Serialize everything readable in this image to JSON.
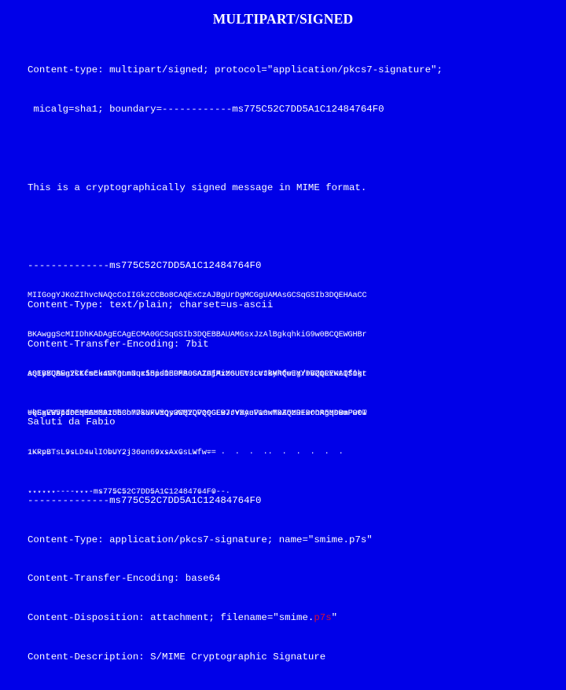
{
  "slide": {
    "title": "MULTIPART/SIGNED",
    "background_color": "#0000e8",
    "text_color": "#ffffff",
    "highlight_color": "#d81038"
  },
  "headers": {
    "line1": "Content-type: multipart/signed; protocol=\"application/pkcs7-signature\";",
    "line2": " micalg=sha1; boundary=------------ms775C52C7DD5A1C12484764F0",
    "blank1": " ",
    "line3": "This is a cryptographically signed message in MIME format.",
    "blank2": " ",
    "line4": "--------------ms775C52C7DD5A1C12484764F0",
    "line5": "Content-Type: text/plain; charset=us-ascii",
    "line6": "Content-Transfer-Encoding: 7bit",
    "blank3": " ",
    "line7": "Saluti da Fabio",
    "blank4": " ",
    "line8": "--------------ms775C52C7DD5A1C12484764F0",
    "line9": "Content-Type: application/pkcs7-signature; name=\"smime.p7s\"",
    "line10": "Content-Transfer-Encoding: base64",
    "line11_prefix": "Content-Disposition: attachment; filename=\"smime.",
    "line11_highlight": "p7s",
    "line11_suffix": "\"",
    "line12": "Content-Description: S/MIME Cryptographic Signature"
  },
  "signature": {
    "base64_top": [
      "MIIGogYJKoZIhvcNAQcCoIIGkzCCBo8CAQExCzAJBgUrDgMCGgUAMAsGCSqGSIb3DQEHAaCC",
      "BKAwggScMIIDhKADAgECAgECMA0GCSqGSIb3DQEBBAUAMGsxJzAlBgkqhkiG9w0BCQEWGHBr",
      "aS1yYUBwa2ktcmEuaWF0LmNuci5pdDEPMA0GA1UEAxMGUEtJLVJBMRQwEgYDVQQLEwtQS0kt",
      "UkEgVW5pdDEMMAoGA1UEChMDSUFUMQswCQYDVQQGEwJJVDAeFw0wMDA5MDExODA5MDBaFw0w"
    ],
    "ellipsis_lines": [
      "......  ..  ...  .....  .  ......  .  .  .  .  .  ..  .  .  .  .  .",
      "......    ...  ......  .  .  .  .  ..  .  ."
    ],
    "base64_bottom": [
      "AQEBBQAEgYCKfsck4CKgnnJqx5Hisi8GFBuSnZAjMiz6uGVscetkyhfoJY/+BZmRYKAIfigr",
      "+QSxE9VIIeeqEGMM9z5b3o77kNxViqy3WM2QPzsGLB7rYXyuV1nxTxZQzR+DrnRgqswmP0tT",
      "1KRpBTsL9sLD4ulIObUY2j36on69xsAxGsLWfw==",
      "--------------ms775C52C7DD5A1C12484764F0--"
    ]
  }
}
